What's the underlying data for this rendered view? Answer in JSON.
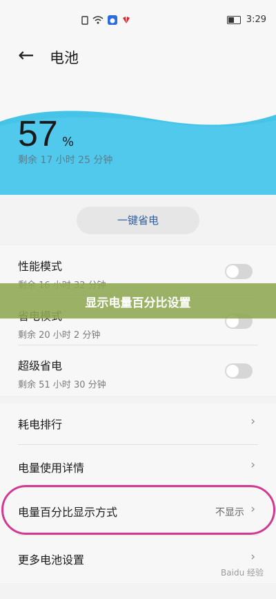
{
  "status_bar": {
    "time": "3:29"
  },
  "header": {
    "title": "电池",
    "back_icon": "arrow-left-icon"
  },
  "battery": {
    "level": "57",
    "percent_sign": "%",
    "remaining": "剩余 17 小时 25 分钟",
    "wave_color": "#46c4e8"
  },
  "one_tap_save": "一键省电",
  "modes": [
    {
      "title": "性能模式",
      "sub": "剩余 16 小时 32 分钟",
      "enabled": false
    },
    {
      "title": "省电模式",
      "sub": "剩余 20 小时 2 分钟",
      "enabled": false
    },
    {
      "title": "超级省电",
      "sub": "剩余 51 小时 30 分钟",
      "enabled": false
    }
  ],
  "settings": [
    {
      "label": "耗电排行",
      "value": ""
    },
    {
      "label": "电量使用详情",
      "value": ""
    },
    {
      "label": "电量百分比显示方式",
      "value": "不显示"
    },
    {
      "label": "更多电池设置",
      "value": ""
    }
  ],
  "overlay_banner": "显示电量百分比设置",
  "watermark": "Baidu 经验"
}
